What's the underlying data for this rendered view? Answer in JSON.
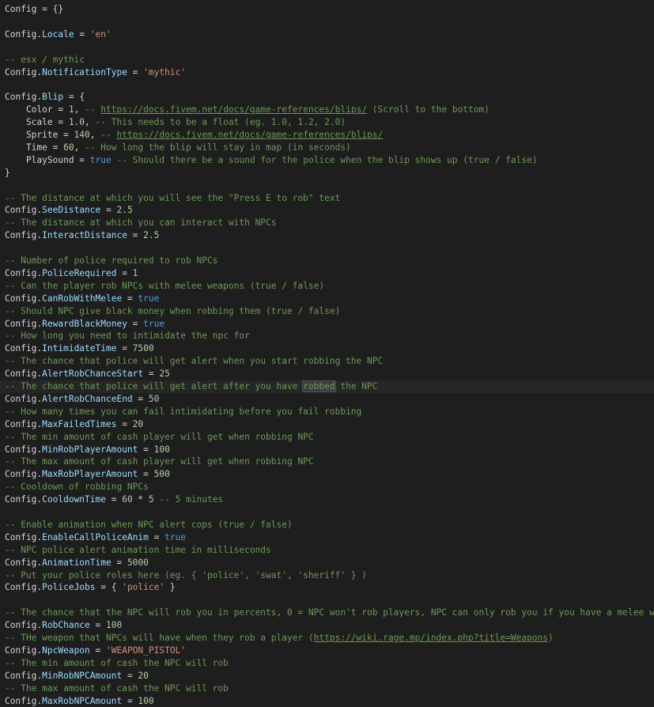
{
  "editor": {
    "language": "lua",
    "current_line": 30,
    "lines": [
      [
        [
          "kw",
          "Config = {}"
        ]
      ],
      [],
      [
        [
          "kw",
          "Config."
        ],
        [
          "prop",
          "Locale"
        ],
        [
          "op",
          " = "
        ],
        [
          "str",
          "'en'"
        ]
      ],
      [],
      [
        [
          "cmt",
          "-- esx / mythic"
        ]
      ],
      [
        [
          "kw",
          "Config."
        ],
        [
          "prop",
          "NotificationType"
        ],
        [
          "op",
          " = "
        ],
        [
          "str",
          "'mythic'"
        ]
      ],
      [],
      [
        [
          "kw",
          "Config."
        ],
        [
          "prop",
          "Blip"
        ],
        [
          "op",
          " = {"
        ]
      ],
      [
        [
          "op",
          "    Color = "
        ],
        [
          "num",
          "1"
        ],
        [
          "op",
          ", "
        ],
        [
          "cmt",
          "-- "
        ],
        [
          "url",
          "https://docs.fivem.net/docs/game-references/blips/"
        ],
        [
          "cmt",
          " (Scroll to the bottom)"
        ]
      ],
      [
        [
          "op",
          "    Scale = "
        ],
        [
          "num",
          "1.0"
        ],
        [
          "op",
          ", "
        ],
        [
          "cmt",
          "-- This needs to be a float (eg. 1.0, 1.2, 2.0)"
        ]
      ],
      [
        [
          "op",
          "    Sprite = "
        ],
        [
          "num",
          "140"
        ],
        [
          "op",
          ", "
        ],
        [
          "cmt",
          "-- "
        ],
        [
          "url",
          "https://docs.fivem.net/docs/game-references/blips/"
        ]
      ],
      [
        [
          "op",
          "    Time = "
        ],
        [
          "num",
          "60"
        ],
        [
          "op",
          ", "
        ],
        [
          "cmt",
          "-- How long the blip will stay in map (in seconds)"
        ]
      ],
      [
        [
          "op",
          "    PlaySound = "
        ],
        [
          "bool",
          "true"
        ],
        [
          "op",
          " "
        ],
        [
          "cmt",
          "-- Should there be a sound for the police when the blip shows up (true / false)"
        ]
      ],
      [
        [
          "op",
          "}"
        ]
      ],
      [],
      [
        [
          "cmt",
          "-- The distance at which you will see the \"Press E to rob\" text"
        ]
      ],
      [
        [
          "kw",
          "Config."
        ],
        [
          "prop",
          "SeeDistance"
        ],
        [
          "op",
          " = "
        ],
        [
          "num",
          "2.5"
        ]
      ],
      [
        [
          "cmt",
          "-- The distance at which you can interact with NPCs"
        ]
      ],
      [
        [
          "kw",
          "Config."
        ],
        [
          "prop",
          "InteractDistance"
        ],
        [
          "op",
          " = "
        ],
        [
          "num",
          "2.5"
        ]
      ],
      [],
      [
        [
          "cmt",
          "-- Number of police required to rob NPCs"
        ]
      ],
      [
        [
          "kw",
          "Config."
        ],
        [
          "prop",
          "PoliceRequired"
        ],
        [
          "op",
          " = "
        ],
        [
          "num",
          "1"
        ]
      ],
      [
        [
          "cmt",
          "-- Can the player rob NPCs with melee weapons (true / false)"
        ]
      ],
      [
        [
          "kw",
          "Config."
        ],
        [
          "prop",
          "CanRobWithMelee"
        ],
        [
          "op",
          " = "
        ],
        [
          "bool",
          "true"
        ]
      ],
      [
        [
          "cmt",
          "-- Should NPC give black money when robbing them (true / false)"
        ]
      ],
      [
        [
          "kw",
          "Config."
        ],
        [
          "prop",
          "RewardBlackMoney"
        ],
        [
          "op",
          " = "
        ],
        [
          "bool",
          "true"
        ]
      ],
      [
        [
          "cmt",
          "-- How long you need to intimidate the npc for"
        ]
      ],
      [
        [
          "kw",
          "Config."
        ],
        [
          "prop",
          "IntimidateTime"
        ],
        [
          "op",
          " = "
        ],
        [
          "num",
          "7500"
        ]
      ],
      [
        [
          "cmt",
          "-- The chance that police will get alert when you start robbing the NPC"
        ]
      ],
      [
        [
          "kw",
          "Config."
        ],
        [
          "prop",
          "AlertRobChanceStart"
        ],
        [
          "op",
          " = "
        ],
        [
          "num",
          "25"
        ]
      ],
      [
        [
          "cmt",
          "-- The chance that police will get alert after you have "
        ],
        [
          "sel",
          "robbed"
        ],
        [
          "cmt",
          " the NPC"
        ]
      ],
      [
        [
          "kw",
          "Config."
        ],
        [
          "prop",
          "AlertRobChanceEnd"
        ],
        [
          "op",
          " = "
        ],
        [
          "num",
          "50"
        ]
      ],
      [
        [
          "cmt",
          "-- How many times you can fail intimidating before you fail robbing"
        ]
      ],
      [
        [
          "kw",
          "Config."
        ],
        [
          "prop",
          "MaxFailedTimes"
        ],
        [
          "op",
          " = "
        ],
        [
          "num",
          "20"
        ]
      ],
      [
        [
          "cmt",
          "-- The min amount of cash player will get when robbing NPC"
        ]
      ],
      [
        [
          "kw",
          "Config."
        ],
        [
          "prop",
          "MinRobPlayerAmount"
        ],
        [
          "op",
          " = "
        ],
        [
          "num",
          "100"
        ]
      ],
      [
        [
          "cmt",
          "-- The max amount of cash player will get when robbing NPC"
        ]
      ],
      [
        [
          "kw",
          "Config."
        ],
        [
          "prop",
          "MaxRobPlayerAmount"
        ],
        [
          "op",
          " = "
        ],
        [
          "num",
          "500"
        ]
      ],
      [
        [
          "cmt",
          "-- Cooldown of robbing NPCs"
        ]
      ],
      [
        [
          "kw",
          "Config."
        ],
        [
          "prop",
          "CooldownTime"
        ],
        [
          "op",
          " = "
        ],
        [
          "num",
          "60"
        ],
        [
          "op",
          " * "
        ],
        [
          "num",
          "5"
        ],
        [
          "op",
          " "
        ],
        [
          "cmt",
          "-- 5 minutes"
        ]
      ],
      [],
      [
        [
          "cmt",
          "-- Enable animation when NPC alert cops (true / false)"
        ]
      ],
      [
        [
          "kw",
          "Config."
        ],
        [
          "prop",
          "EnableCallPoliceAnim"
        ],
        [
          "op",
          " = "
        ],
        [
          "bool",
          "true"
        ]
      ],
      [
        [
          "cmt",
          "-- NPC police alert animation time in milliseconds"
        ]
      ],
      [
        [
          "kw",
          "Config."
        ],
        [
          "prop",
          "AnimationTime"
        ],
        [
          "op",
          " = "
        ],
        [
          "num",
          "5000"
        ]
      ],
      [
        [
          "cmt",
          "-- Put your police roles here (eg. { 'police', 'swat', 'sheriff' } )"
        ]
      ],
      [
        [
          "kw",
          "Config."
        ],
        [
          "prop",
          "PoliceJobs"
        ],
        [
          "op",
          " = { "
        ],
        [
          "str",
          "'police'"
        ],
        [
          "op",
          " }"
        ]
      ],
      [],
      [
        [
          "cmt",
          "-- The chance that the NPC will rob you in percents, 0 = NPC won't rob players, NPC can only rob you if you have a melee weapon"
        ]
      ],
      [
        [
          "kw",
          "Config."
        ],
        [
          "prop",
          "RobChance"
        ],
        [
          "op",
          " = "
        ],
        [
          "num",
          "100"
        ]
      ],
      [
        [
          "cmt",
          "-- THe weapon that NPCs will have when they rob a player ("
        ],
        [
          "url",
          "https://wiki.rage.mp/index.php?title=Weapons"
        ],
        [
          "cmt",
          ")"
        ]
      ],
      [
        [
          "kw",
          "Config."
        ],
        [
          "prop",
          "NpcWeapon"
        ],
        [
          "op",
          " = "
        ],
        [
          "str",
          "'WEAPON_PISTOL'"
        ]
      ],
      [
        [
          "cmt",
          "-- The min amount of cash the NPC will rob"
        ]
      ],
      [
        [
          "kw",
          "Config."
        ],
        [
          "prop",
          "MinRobNPCAmount"
        ],
        [
          "op",
          " = "
        ],
        [
          "num",
          "20"
        ]
      ],
      [
        [
          "cmt",
          "-- The max amount of cash the NPC will rob"
        ]
      ],
      [
        [
          "kw",
          "Config."
        ],
        [
          "prop",
          "MaxRobNPCAmount"
        ],
        [
          "op",
          " = "
        ],
        [
          "num",
          "100"
        ]
      ]
    ]
  }
}
